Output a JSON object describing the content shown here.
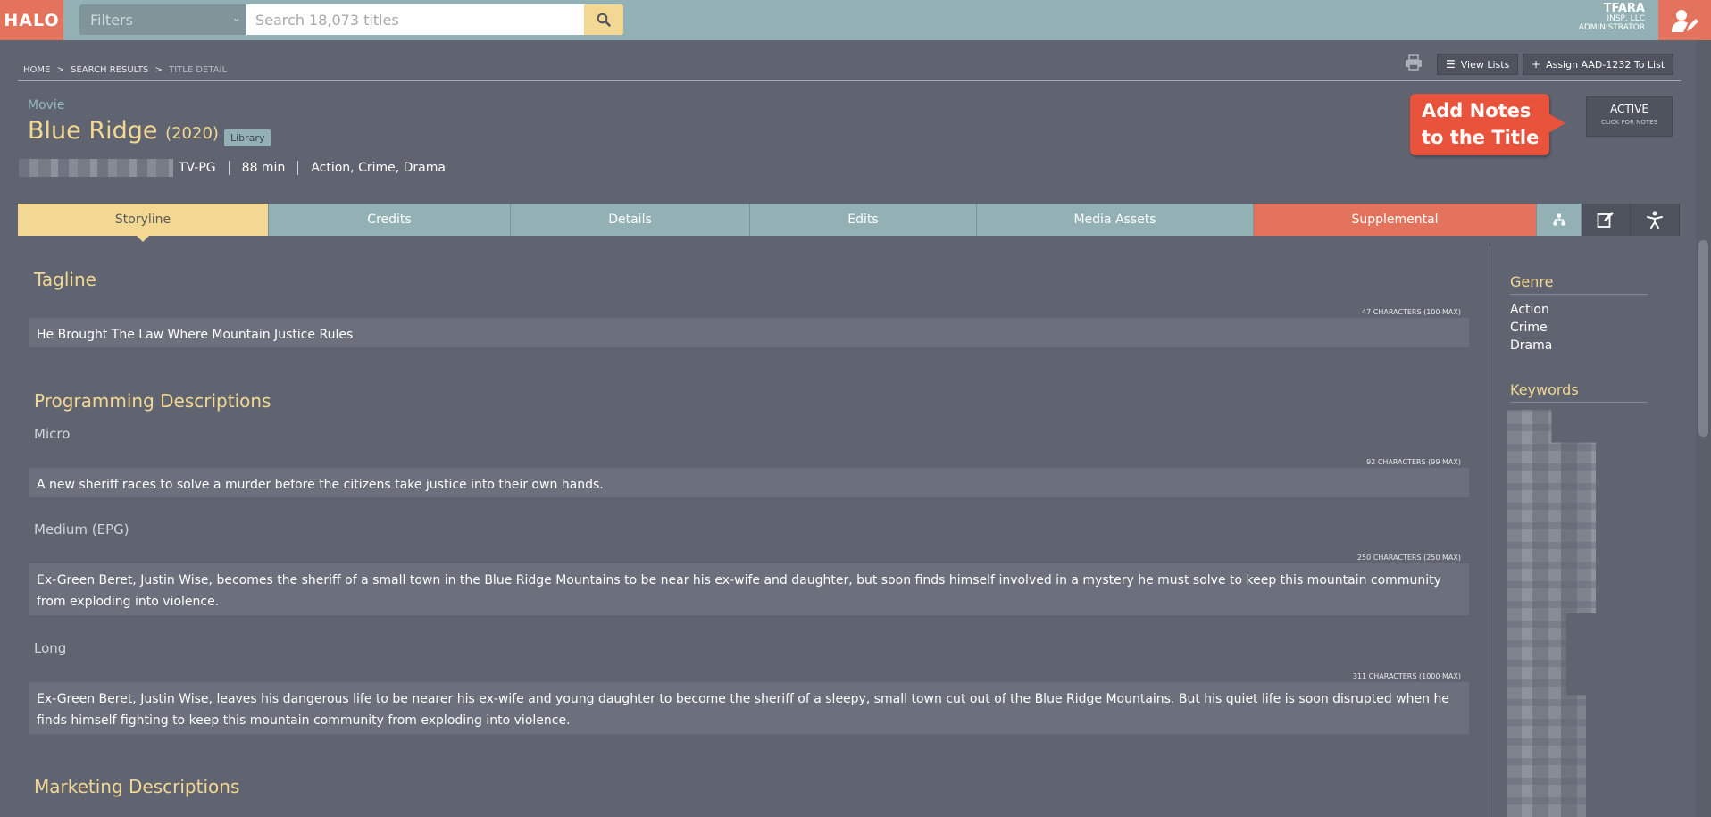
{
  "app": {
    "logo": "HALO"
  },
  "search": {
    "filters_label": "Filters",
    "placeholder": "Search 18,073 titles"
  },
  "user": {
    "name": "TFARA",
    "company": "INSP, LLC",
    "role": "ADMINISTRATOR"
  },
  "breadcrumb": [
    "HOME",
    "SEARCH RESULTS",
    "TITLE DETAIL"
  ],
  "breadcrumb_sep": ">",
  "toolbar": {
    "view_lists": "View Lists",
    "assign": "Assign AAD-1232 To List"
  },
  "title": {
    "type": "Movie",
    "name": "Blue Ridge",
    "year": "(2020)",
    "badge": "Library",
    "rating": "TV-PG",
    "runtime": "88 min",
    "genres": "Action, Crime, Drama"
  },
  "callout": {
    "line1": "Add Notes",
    "line2": "to the Title"
  },
  "status": {
    "label": "ACTIVE",
    "sub": "CLICK FOR NOTES"
  },
  "tabs": [
    {
      "label": "Storyline"
    },
    {
      "label": "Credits"
    },
    {
      "label": "Details"
    },
    {
      "label": "Edits"
    },
    {
      "label": "Media Assets"
    },
    {
      "label": "Supplemental"
    }
  ],
  "icon_tabs": [
    "hierarchy-icon",
    "edit-icon",
    "accessibility-icon"
  ],
  "storyline": {
    "tagline_heading": "Tagline",
    "tagline_count": "47 CHARACTERS (100 MAX)",
    "tagline": "He Brought The Law Where Mountain Justice Rules",
    "programming_heading": "Programming Descriptions",
    "micro_label": "Micro",
    "micro_count": "92 CHARACTERS (99 MAX)",
    "micro": "A new sheriff races to solve a murder before the citizens take justice into their own hands.",
    "medium_label": "Medium (EPG)",
    "medium_count": "250 CHARACTERS (250 MAX)",
    "medium": "Ex-Green Beret, Justin Wise, becomes the sheriff of a small town in the Blue Ridge Mountains to be near his ex-wife and daughter, but soon finds himself involved in a mystery he must solve to keep this mountain community from exploding into violence.",
    "long_label": "Long",
    "long_count": "311 CHARACTERS (1000 MAX)",
    "long": "Ex-Green Beret, Justin Wise, leaves his dangerous life to be nearer his ex-wife and young daughter to become the sheriff of a sleepy, small town cut out of the Blue Ridge Mountains. But his quiet life is soon disrupted when he finds himself fighting to keep this mountain community from exploding into violence.",
    "marketing_heading": "Marketing Descriptions"
  },
  "sidebar": {
    "genre_heading": "Genre",
    "genres": [
      "Action",
      "Crime",
      "Drama"
    ],
    "keywords_heading": "Keywords"
  },
  "colors": {
    "accent": "#f2d892",
    "brand": "#e3735c",
    "teal": "#93b1b4",
    "bg": "#5f6470"
  }
}
